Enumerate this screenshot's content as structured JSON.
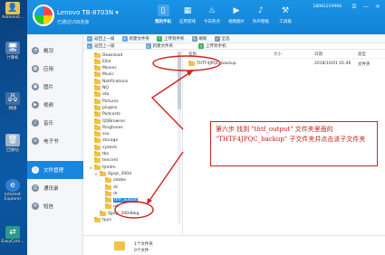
{
  "desktop": {
    "icons": [
      {
        "label": "Administ...",
        "icon": "user-folder-icon"
      },
      {
        "label": "计算机",
        "icon": "computer-icon"
      },
      {
        "label": "网络",
        "icon": "network-icon"
      },
      {
        "label": "回收站",
        "icon": "recycle-bin-icon"
      },
      {
        "label": "Internet Explorer",
        "icon": "ie-icon"
      },
      {
        "label": "EasyCom...",
        "icon": "easycom-icon"
      }
    ]
  },
  "titlebar": {
    "device_name": "Lenovo TB-8703N",
    "device_sub": "已通过USB连接",
    "phone_number": "18081219968",
    "nav_tabs": [
      {
        "label": "我的手机",
        "icon": "phone-icon"
      },
      {
        "label": "应用游戏",
        "icon": "apps-icon"
      },
      {
        "label": "今日热点",
        "icon": "fire-icon"
      },
      {
        "label": "视频图片",
        "icon": "video-icon"
      },
      {
        "label": "铃声壁纸",
        "icon": "music-icon"
      },
      {
        "label": "工具箱",
        "icon": "toolbox-icon"
      }
    ],
    "controls": [
      "☰",
      "—",
      "✕"
    ]
  },
  "leftnav": {
    "items": [
      {
        "label": "概况",
        "icon": "overview-icon",
        "active": false
      },
      {
        "label": "应用",
        "icon": "apps-icon",
        "active": false
      },
      {
        "label": "图片",
        "icon": "picture-icon",
        "active": false
      },
      {
        "label": "视频",
        "icon": "video-icon",
        "active": false
      },
      {
        "label": "音乐",
        "icon": "music-icon",
        "active": false
      },
      {
        "label": "电子书",
        "icon": "ebook-icon",
        "active": false
      },
      {
        "label": "文件管理",
        "icon": "folder-icon",
        "active": true
      },
      {
        "label": "通讯录",
        "icon": "contacts-icon",
        "active": false
      },
      {
        "label": "短信",
        "icon": "sms-icon",
        "active": false
      }
    ]
  },
  "toolbar1": {
    "buttons": [
      "返回上一级",
      "新建文件夹",
      "上传到手机",
      "刷新",
      "全选"
    ]
  },
  "toolbar2": {
    "buttons": [
      "返回上一级",
      "新建文件夹",
      "上传到手机"
    ]
  },
  "tree": {
    "nodes": [
      {
        "label": "Download",
        "depth": 0,
        "expander": ""
      },
      {
        "label": "Ellie",
        "depth": 0,
        "expander": ""
      },
      {
        "label": "Movies",
        "depth": 0,
        "expander": ""
      },
      {
        "label": "Music",
        "depth": 0,
        "expander": ""
      },
      {
        "label": "Notifications",
        "depth": 0,
        "expander": ""
      },
      {
        "label": "NQ",
        "depth": 0,
        "expander": ""
      },
      {
        "label": "ota",
        "depth": 0,
        "expander": ""
      },
      {
        "label": "Pictures",
        "depth": 0,
        "expander": ""
      },
      {
        "label": "plugins",
        "depth": 0,
        "expander": ""
      },
      {
        "label": "Podcasts",
        "depth": 0,
        "expander": ""
      },
      {
        "label": "QQBrowser",
        "depth": 0,
        "expander": ""
      },
      {
        "label": "Ringtones",
        "depth": 0,
        "expander": ""
      },
      {
        "label": "sso",
        "depth": 0,
        "expander": ""
      },
      {
        "label": "storage",
        "depth": 0,
        "expander": ""
      },
      {
        "label": "system",
        "depth": 0,
        "expander": ""
      },
      {
        "label": "tbs",
        "depth": 0,
        "expander": ""
      },
      {
        "label": "tencent",
        "depth": 0,
        "expander": ""
      },
      {
        "label": "tjmdm",
        "depth": 0,
        "expander": "⊖"
      },
      {
        "label": "4jpqc_300d",
        "depth": 1,
        "expander": "⊖"
      },
      {
        "label": "adobe",
        "depth": 2,
        "expander": ""
      },
      {
        "label": "dc",
        "depth": 2,
        "expander": ""
      },
      {
        "label": "dr",
        "depth": 2,
        "expander": ""
      },
      {
        "label": "thtf_output",
        "depth": 2,
        "expander": "",
        "selected": true
      },
      {
        "label": "ud",
        "depth": 2,
        "expander": ""
      },
      {
        "label": "4jpqc_300dbkg",
        "depth": 1,
        "expander": ""
      },
      {
        "label": "tpyo",
        "depth": 0,
        "expander": ""
      }
    ]
  },
  "list": {
    "headers": [
      "名称",
      "大小",
      "日期",
      "类型"
    ],
    "rows": [
      {
        "name": "THTF4JPQC_backup",
        "size": "",
        "date": "2018/10/01 01:46",
        "type": "文件夹"
      }
    ]
  },
  "status": {
    "line1": "1个文件夹",
    "line2": "0个文件"
  },
  "annotation": {
    "text": "第六步 找到 \"thtf_output\" 文件夹里面的 \"THTF4JPQC_backup\" 子文件夹并点击该子文件夹"
  },
  "colors": {
    "titlebar": "#1283d6",
    "accent": "#1a86db",
    "annotation_red": "#d42020",
    "folder_yellow": "#f1c24a"
  }
}
